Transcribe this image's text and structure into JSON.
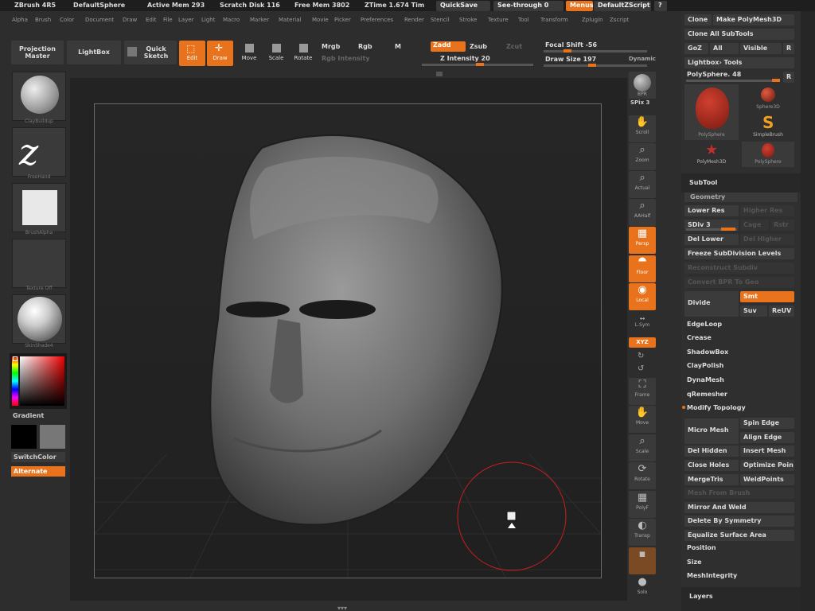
{
  "titlebar": {
    "app": "ZBrush 4R5",
    "document": "DefaultSphere",
    "active_mem": "Active Mem 293",
    "scratch_disk": "Scratch Disk 116",
    "free_mem": "Free Mem 3802",
    "ztime": "ZTime 1.674 Tim",
    "quicksave": "QuickSave",
    "see_through": "See-through  0",
    "menus": "Menus",
    "script": "DefaultZScript"
  },
  "menus": [
    "Alpha",
    "Brush",
    "Color",
    "Document",
    "Draw",
    "Edit",
    "File",
    "Layer",
    "Light",
    "Macro",
    "Marker",
    "Material",
    "Movie",
    "Picker",
    "Preferences",
    "Render",
    "Stencil",
    "Stroke",
    "Texture",
    "Tool",
    "Transform",
    "Zplugin",
    "Zscript"
  ],
  "toolbar": {
    "projection_master": "Projection Master",
    "lightbox": "LightBox",
    "quick_sketch": "Quick Sketch",
    "edit": "Edit",
    "draw": "Draw",
    "move": "Move",
    "scale": "Scale",
    "rotate": "Rotate",
    "mrgb": "Mrgb",
    "rgb": "Rgb",
    "m": "M",
    "rgb_intensity": "Rgb  Intensity",
    "zadd": "Zadd",
    "zsub": "Zsub",
    "zcut": "Zcut",
    "z_intensity": "Z Intensity 20",
    "focal_shift": "Focal Shift -56",
    "draw_size": "Draw Size 197",
    "dynamic": "Dynamic"
  },
  "left_shelf": {
    "brush": "ClayBuildup",
    "stroke": "FreeHand",
    "alpha": "BrushAlpha",
    "texture": "Texture Off",
    "material": "SkinShade4",
    "gradient": "Gradient",
    "switch_color": "SwitchColor",
    "alternate": "Alternate"
  },
  "right_shelf": {
    "bpr": "BPR",
    "spix": "SPix 3",
    "scroll": "Scroll",
    "zoom": "Zoom",
    "actual": "Actual",
    "aahalf": "AAHalf",
    "persp": "Persp",
    "floor": "Floor",
    "local": "Local",
    "lsym": "L.Sym",
    "xyz": "XYZ",
    "frame": "Frame",
    "move": "Move",
    "scale": "Scale",
    "rotate": "Rotate",
    "polyf": "PolyF",
    "transp": "Transp",
    "solo": "Solo"
  },
  "tool_panel": {
    "clone": "Clone",
    "make_polymesh": "Make PolyMesh3D",
    "clone_all_subtools": "Clone All SubTools",
    "goz": "GoZ",
    "all": "All",
    "visible": "Visible",
    "r": "R",
    "lightbox_tools": "Lightbox› Tools",
    "polysphere_slider": "PolySphere. 48",
    "tools": [
      {
        "name": "PolySphere"
      },
      {
        "name": "Sphere3D"
      },
      {
        "name": "SimpleBrush"
      },
      {
        "name": "PolyMesh3D"
      },
      {
        "name": "PolySphere"
      }
    ],
    "subtool": "SubTool",
    "geometry": "Geometry",
    "lower_res": "Lower Res",
    "higher_res": "Higher Res",
    "sdiv": "SDiv 3",
    "cage": "Cage",
    "rstr": "Rstr",
    "del_lower": "Del Lower",
    "del_higher": "Del Higher",
    "freeze_subdivision": "Freeze SubDivision Levels",
    "reconstruct_subdiv": "Reconstruct Subdiv",
    "convert_bpr": "Convert BPR To Geo",
    "divide": "Divide",
    "smt": "Smt",
    "suv": "Suv",
    "reuv": "ReUV",
    "edgeloop": "EdgeLoop",
    "crease": "Crease",
    "shadowbox": "ShadowBox",
    "claypolish": "ClayPolish",
    "dynamesh": "DynaMesh",
    "qremesher": "qRemesher",
    "modify_topology": "Modify Topology",
    "micro_mesh": "Micro Mesh",
    "spin_edge": "Spin Edge",
    "align_edge": "Align Edge",
    "del_hidden": "Del Hidden",
    "insert_mesh": "Insert Mesh",
    "close_holes": "Close Holes",
    "optimize_points": "Optimize Poin",
    "merge_tris": "MergeTris",
    "weld_points": "WeldPoints",
    "mesh_from_brush": "Mesh From Brush",
    "mirror_and_weld": "Mirror And Weld",
    "delete_by_symmetry": "Delete By Symmetry",
    "equalize_surface": "Equalize Surface Area",
    "position": "Position",
    "size": "Size",
    "mesh_integrity": "MeshIntegrity",
    "layers": "Layers"
  },
  "colors": {
    "accent": "#e8731c",
    "panel": "#2f2f2f",
    "canvas": "#232323",
    "brush_ring": "#c81e1e"
  }
}
